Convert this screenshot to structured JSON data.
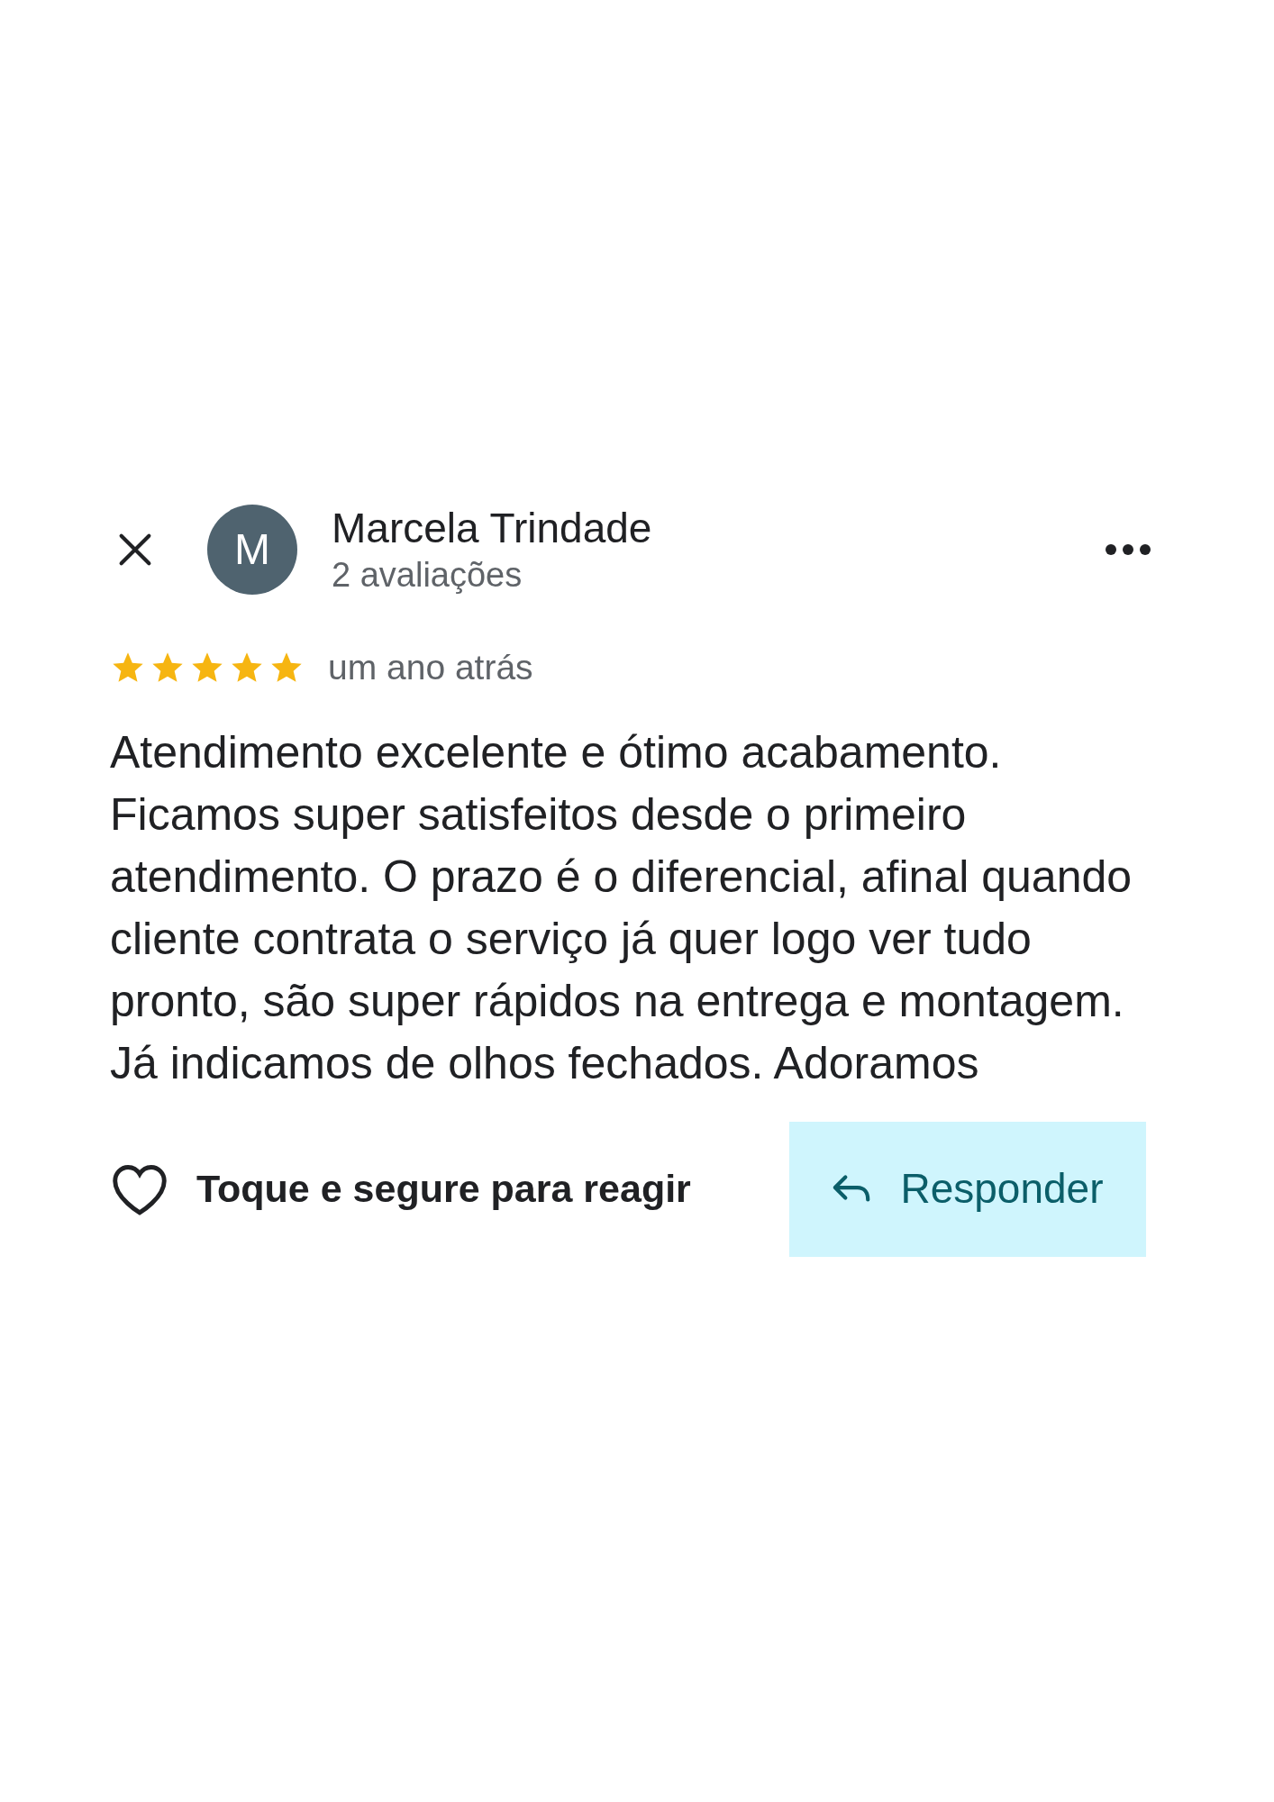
{
  "reviewer": {
    "initial": "M",
    "name": "Marcela Trindade",
    "review_count": "2 avaliações"
  },
  "rating": {
    "stars": 5,
    "time": "um ano atrás"
  },
  "review_text": "Atendimento excelente e ótimo acabamento. Ficamos super satisfeitos desde o primeiro atendimento. O prazo é o diferencial, afinal quando cliente contrata o serviço já quer logo ver tudo pronto, são super rápidos na entrega e montagem. Já indicamos de olhos fechados. Adoramos",
  "reaction": {
    "label": "Toque e segure para reagir"
  },
  "reply_button": {
    "label": "Responder"
  }
}
